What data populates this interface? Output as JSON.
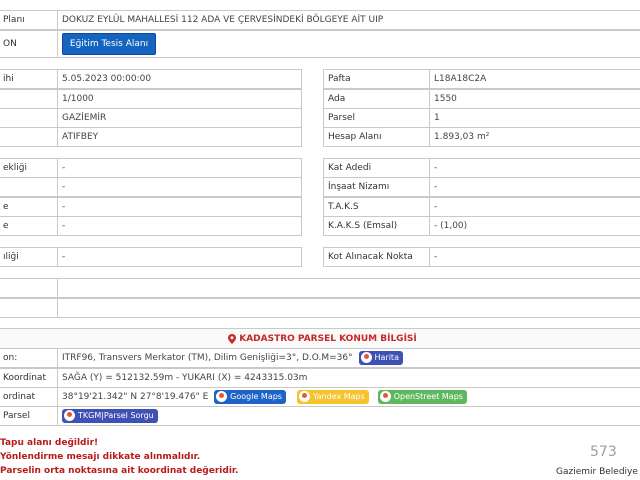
{
  "top": {
    "plan_label": "Planı",
    "plan_value": "DOKUZ EYLÜL MAHALLESİ 112 ADA VE ÇERVESİNDEKİ BÖLGEYE AİT UIP",
    "row2_label": "ON",
    "egitim_button": "Eğitim Tesis Alanı"
  },
  "left_block1": [
    {
      "label": "ihi",
      "value": "5.05.2023 00:00:00"
    },
    {
      "label": "",
      "value": "1/1000"
    },
    {
      "label": "",
      "value": "GAZİEMİR"
    },
    {
      "label": "",
      "value": "ATIFBEY"
    }
  ],
  "right_block1": [
    {
      "label": "Pafta",
      "value": "L18A18C2A"
    },
    {
      "label": "Ada",
      "value": "1550"
    },
    {
      "label": "Parsel",
      "value": "1"
    },
    {
      "label": "Hesap Alanı",
      "value": "1.893,03 m²"
    }
  ],
  "left_block2": [
    {
      "label": "ekliği",
      "value": "-"
    },
    {
      "label": "",
      "value": "-"
    },
    {
      "label": "e",
      "value": "-"
    },
    {
      "label": "e",
      "value": "-"
    }
  ],
  "right_block2": [
    {
      "label": "Kat Adedi",
      "value": "-"
    },
    {
      "label": "İnşaat Nizamı",
      "value": "-"
    },
    {
      "label": "T.A.K.S",
      "value": "-"
    },
    {
      "label": "K.A.K.S (Emsal)",
      "value": "- (1,00)"
    }
  ],
  "left_block3": {
    "label": "ıliği",
    "value": "-"
  },
  "right_block3": {
    "label": "Kot Alınacak Nokta",
    "value": "-"
  },
  "kadastro": {
    "title": "KADASTRO PARSEL KONUM BİLGİSİ",
    "rows": [
      {
        "label": "on:",
        "value": "ITRF96, Transvers Merkator (TM), Dilim Genişliği=3°, D.O.M=36°"
      },
      {
        "label": "Koordinat",
        "value": "SAĞA (Y) = 512132.59m - YUKARI (X) = 4243315.03m"
      },
      {
        "label": "ordinat",
        "value": "38°19'21.342\" N 27°8'19.476\" E"
      },
      {
        "label": "Parsel",
        "value": ""
      }
    ],
    "harita_btn": "Harita",
    "google_btn": "Google Maps",
    "yandex_btn": "Yandex Maps",
    "osm_btn": "OpenStreet Maps",
    "tkgm_btn": "TKGM|Parsel Sorgu"
  },
  "warnings": [
    "Tapu alanı değildir!",
    "Yönlendirme mesajı dikkate alınmalıdır.",
    "Parselin orta noktasına ait koordinat değeridir."
  ],
  "footer": {
    "municipality": "Gaziemir Belediye",
    "counter": "573"
  },
  "colors": {
    "harita": "#3f51b5",
    "google": "#1e63c8",
    "yandex": "#f6c22d",
    "osm": "#5fb85f",
    "tkgm": "#3f51b5"
  }
}
